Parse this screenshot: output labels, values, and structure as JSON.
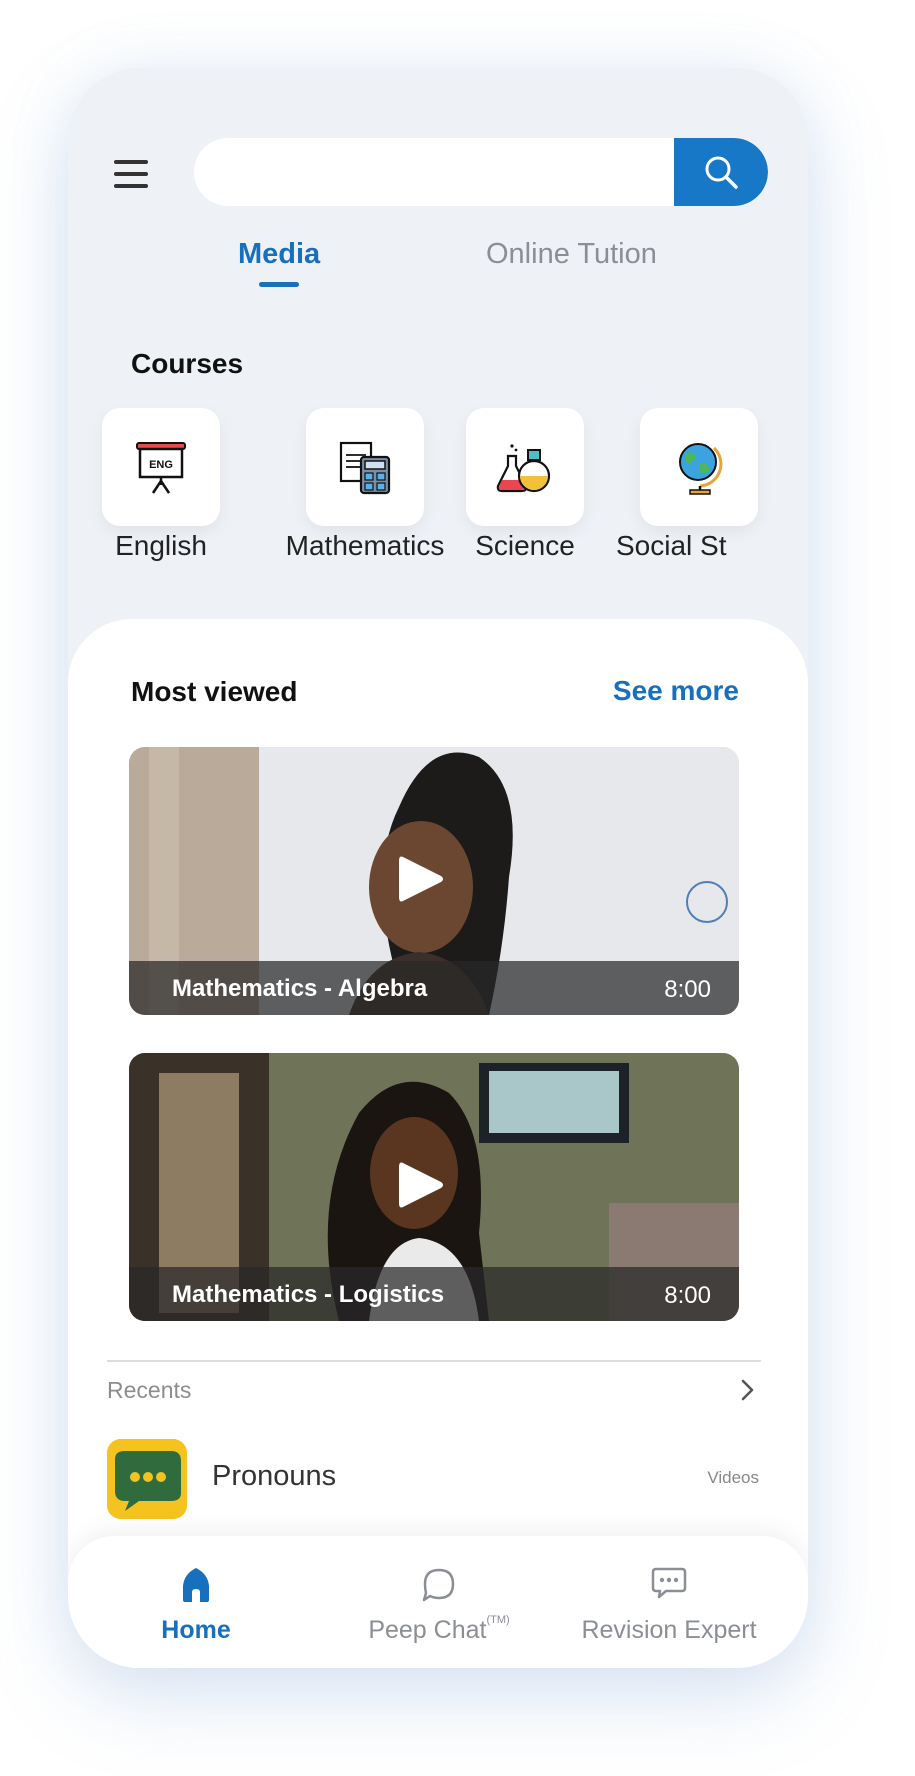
{
  "search": {
    "placeholder": "",
    "value": ""
  },
  "tabs": [
    {
      "label": "Media",
      "active": true
    },
    {
      "label": "Online Tution",
      "active": false
    }
  ],
  "courses": {
    "title": "Courses",
    "items": [
      {
        "label": "English",
        "icon": "presentation-board-icon",
        "board_text": "ENG"
      },
      {
        "label": "Mathematics",
        "icon": "calculator-icon"
      },
      {
        "label": "Science",
        "icon": "flasks-icon"
      },
      {
        "label": "Social St",
        "icon": "globe-icon"
      }
    ]
  },
  "most_viewed": {
    "title": "Most viewed",
    "see_more": "See more",
    "videos": [
      {
        "title": "Mathematics - Algebra",
        "duration": "8:00"
      },
      {
        "title": "Mathematics - Logistics",
        "duration": "8:00"
      }
    ]
  },
  "recents": {
    "label": "Recents",
    "items": [
      {
        "name": "Pronouns",
        "type": "Videos",
        "icon": "chat-bubble-icon"
      }
    ]
  },
  "bottom_nav": {
    "items": [
      {
        "label": "Home",
        "icon": "home-icon",
        "active": true
      },
      {
        "label": "Peep Chat",
        "superscript": "(TM)",
        "icon": "chat-bubble-outline-icon",
        "active": false
      },
      {
        "label": "Revision Expert",
        "icon": "chat-dots-icon",
        "active": false
      }
    ]
  },
  "colors": {
    "accent": "#1670bd",
    "search_button": "#1878c8",
    "background": "#eef1f5"
  }
}
